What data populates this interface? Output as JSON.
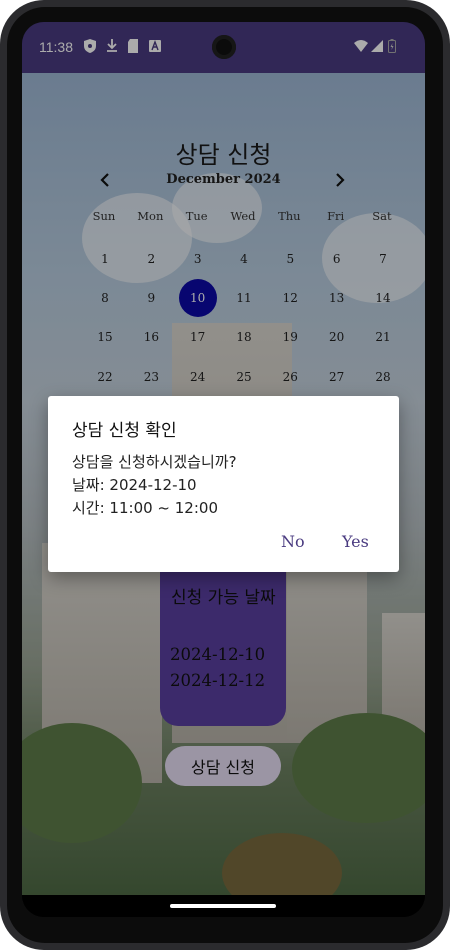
{
  "status_bar": {
    "time": "11:38",
    "left_icons": [
      "shield-icon",
      "download-icon",
      "sd-card-icon",
      "font-icon"
    ],
    "right_icons": [
      "wifi-icon",
      "signal-icon",
      "battery-icon"
    ]
  },
  "app": {
    "title": "상담 신청"
  },
  "calendar": {
    "month_label": "December 2024",
    "prev_icon": "chevron-left-icon",
    "next_icon": "chevron-right-icon",
    "weekdays": [
      "Sun",
      "Mon",
      "Tue",
      "Wed",
      "Thu",
      "Fri",
      "Sat"
    ],
    "weeks": [
      [
        "1",
        "2",
        "3",
        "4",
        "5",
        "6",
        "7"
      ],
      [
        "8",
        "9",
        "10",
        "11",
        "12",
        "13",
        "14"
      ],
      [
        "15",
        "16",
        "17",
        "18",
        "19",
        "20",
        "21"
      ],
      [
        "22",
        "23",
        "24",
        "25",
        "26",
        "27",
        "28"
      ]
    ],
    "selected_day": "10"
  },
  "available": {
    "title": "신청 가능 날짜",
    "dates": [
      "2024-12-10",
      "2024-12-12"
    ]
  },
  "apply_button": "상담 신청",
  "dialog": {
    "title": "상담 신청 확인",
    "message": "상담을 신청하시겠습니까?",
    "date_line": "날짜: 2024-12-10",
    "time_line": "시간: 11:00 ~ 12:00",
    "no_label": "No",
    "yes_label": "Yes"
  },
  "colors": {
    "accent": "#4a3b80",
    "selected_day": "#0d09a8",
    "available_box": "#5a3fa0"
  }
}
